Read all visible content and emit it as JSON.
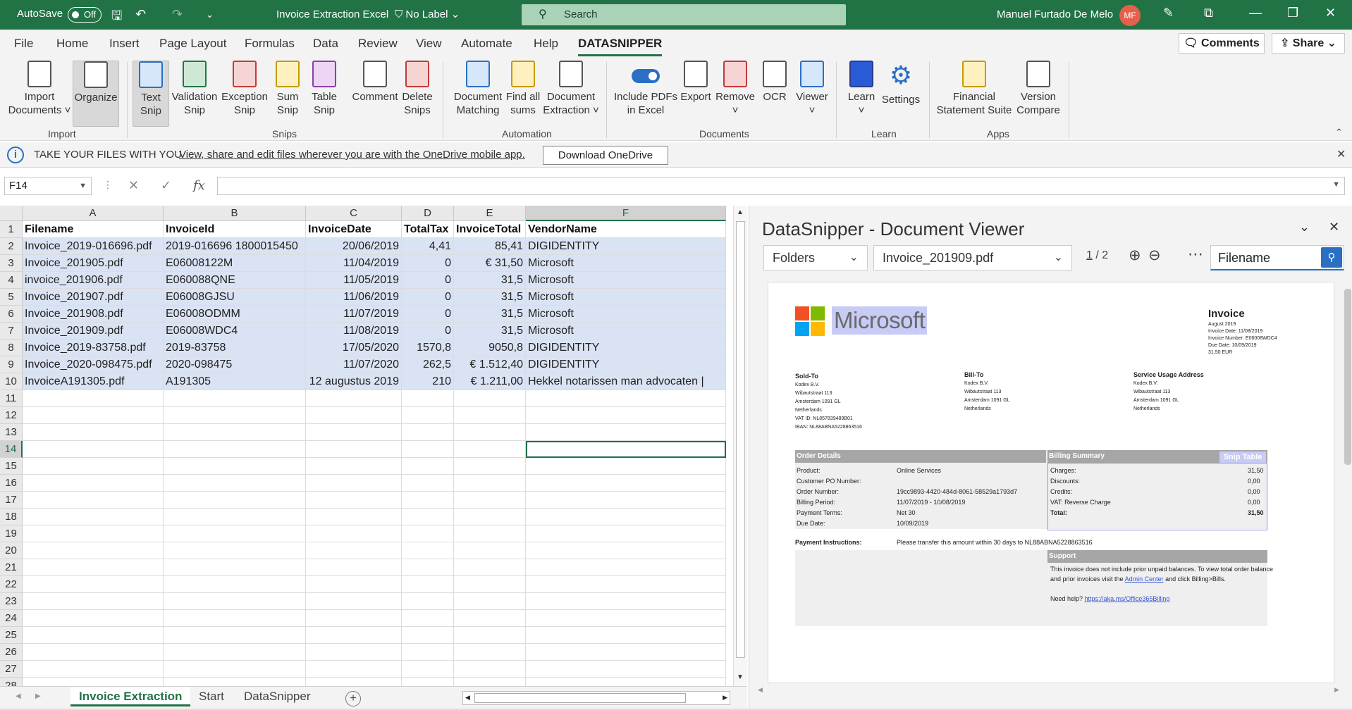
{
  "titlebar": {
    "autosave_label": "AutoSave",
    "autosave_state": "Off",
    "file_title": "Invoice Extraction Excel",
    "sensitivity": "No Label",
    "search_placeholder": "Search",
    "user_name": "Manuel Furtado De Melo",
    "user_initials": "MF"
  },
  "ribbon_tabs": [
    "File",
    "Home",
    "Insert",
    "Page Layout",
    "Formulas",
    "Data",
    "Review",
    "View",
    "Automate",
    "Help",
    "DATASNIPPER"
  ],
  "ribbon_actions": {
    "comments": "Comments",
    "share": "Share"
  },
  "ribbon": {
    "import_documents": [
      "Import",
      "Documents ˅"
    ],
    "organize": "Organize",
    "text_snip": [
      "Text",
      "Snip"
    ],
    "validation_snip": [
      "Validation",
      "Snip"
    ],
    "exception_snip": [
      "Exception",
      "Snip"
    ],
    "sum_snip": [
      "Sum",
      "Snip"
    ],
    "table_snip": [
      "Table",
      "Snip"
    ],
    "comment": "Comment",
    "delete_snips": [
      "Delete",
      "Snips"
    ],
    "document_matching": [
      "Document",
      "Matching"
    ],
    "find_all_sums": [
      "Find all",
      "sums"
    ],
    "document_extraction": [
      "Document",
      "Extraction ˅"
    ],
    "include_pdfs": [
      "Include PDFs",
      "in Excel"
    ],
    "export": "Export",
    "remove": "Remove",
    "ocr": "OCR",
    "viewer": "Viewer",
    "learn": "Learn",
    "settings": "Settings",
    "financial_statement_suite": [
      "Financial",
      "Statement Suite"
    ],
    "version_compare": [
      "Version",
      "Compare"
    ],
    "groups": [
      "Import",
      "Snips",
      "Automation",
      "Documents",
      "Learn",
      "Apps"
    ]
  },
  "message_bar": {
    "title": "TAKE YOUR FILES WITH YOU",
    "link": "View, share and edit files wherever you are with the OneDrive mobile app.",
    "button": "Download OneDrive"
  },
  "formula_bar": {
    "name_box": "F14",
    "fx": "fx",
    "value": ""
  },
  "sheet": {
    "columns": [
      "A",
      "B",
      "C",
      "D",
      "E",
      "F"
    ],
    "rows": [
      [
        "Filename",
        "InvoiceId",
        "InvoiceDate",
        "TotalTax",
        "InvoiceTotal",
        "VendorName"
      ],
      [
        "Invoice_2019-016696.pdf",
        "2019-016696 1800015450",
        "20/06/2019",
        "4,41",
        "85,41",
        "DIGIDENTITY"
      ],
      [
        "Invoice_201905.pdf",
        "E06008122M",
        "11/04/2019",
        "0",
        "€        31,50",
        " Microsoft"
      ],
      [
        "invoice_201906.pdf",
        "E060088QNE",
        "11/05/2019",
        "0",
        "31,5",
        "Microsoft"
      ],
      [
        "Invoice_201907.pdf",
        "E06008GJSU",
        "11/06/2019",
        "0",
        "31,5",
        "Microsoft"
      ],
      [
        "Invoice_201908.pdf",
        "E06008ODMM",
        "11/07/2019",
        "0",
        "31,5",
        "Microsoft"
      ],
      [
        "Invoice_201909.pdf",
        "E06008WDC4",
        "11/08/2019",
        "0",
        "31,5",
        "Microsoft"
      ],
      [
        "Invoice_2019-83758.pdf",
        "2019-83758",
        "17/05/2020",
        "1570,8",
        "9050,8",
        "DIGIDENTITY"
      ],
      [
        "Invoice_2020-098475.pdf",
        "2020-098475",
        "11/07/2020",
        "262,5",
        "€   1.512,40",
        " DIGIDENTITY"
      ],
      [
        "InvoiceA191305.pdf",
        "A191305",
        "12 augustus 2019",
        "210",
        "€   1.211,00",
        " Hekkel notarissen man advocaten |"
      ]
    ],
    "row_numbers": [
      "1",
      "2",
      "3",
      "4",
      "5",
      "6",
      "7",
      "8",
      "9",
      "10",
      "11",
      "12",
      "13",
      "14",
      "15",
      "16",
      "17",
      "18",
      "19",
      "20",
      "21",
      "22",
      "23",
      "24",
      "25",
      "26",
      "27",
      "28"
    ],
    "selected_cell": "F14"
  },
  "sheet_tabs": [
    "Invoice Extraction",
    "Start",
    "DataSnipper"
  ],
  "viewer": {
    "title": "DataSnipper - Document Viewer",
    "folders": "Folders",
    "document": "Invoice_201909.pdf",
    "page_current": "1",
    "page_total": "/ 2",
    "search_field": "Filename"
  },
  "invoice": {
    "vendor": "Microsoft",
    "heading": "Invoice",
    "meta": [
      "August 2019",
      "Invoice Date: 11/08/2019",
      "Invoice Number: E06008WDC4",
      "Due Date: 10/09/2019",
      "31,50 EUR"
    ],
    "sold_to": {
      "label": "Sold-To",
      "lines": [
        "Kodex B.V.",
        "Wibautstraat 113",
        "Amsterdam 1091 GL",
        "Netherlands",
        "VAT ID: NL857839489B01",
        "IBAN: NL88ABNA5228863516"
      ]
    },
    "bill_to": {
      "label": "Bill-To",
      "lines": [
        "Kodex B.V.",
        "Wibautstraat 113",
        "Amsterdam 1091 GL",
        "Netherlands"
      ]
    },
    "service_address": {
      "label": "Service Usage Address",
      "lines": [
        "Kodex B.V.",
        "Wibautstraat 113",
        "Amsterdam 1091 GL",
        "Netherlands"
      ]
    },
    "order_details_title": "Order Details",
    "billing_summary_title": "Billing Summary",
    "snip_label": "Snip Table",
    "order_details": [
      [
        "Product:",
        "Online Services"
      ],
      [
        "Customer PO Number:",
        ""
      ],
      [
        "Order Number:",
        "19cc9893-4420-484d-8061-58529a1793d7"
      ],
      [
        "Billing Period:",
        "11/07/2019 - 10/08/2019"
      ],
      [
        "Payment Terms:",
        "Net 30"
      ],
      [
        "Due Date:",
        "10/09/2019"
      ]
    ],
    "billing_summary": [
      [
        "Charges:",
        "31,50"
      ],
      [
        "Discounts:",
        "0,00"
      ],
      [
        "Credits:",
        "0,00"
      ],
      [
        "VAT: Reverse Charge",
        "0,00"
      ],
      [
        "Total:",
        "31,50"
      ]
    ],
    "payment_label": "Payment Instructions:",
    "payment_text": "Please transfer this amount within 30 days to NL88ABNA5228863516",
    "support_title": "Support",
    "support_line1": "This invoice does not include prior unpaid balances. To view total order balance",
    "support_line2_a": "and prior invoices visit the ",
    "support_link": "Admin Center",
    "support_line2_b": " and click Billing>Bills.",
    "help_label": "Need help? ",
    "help_link": "https://aka.ms/Office365Billing"
  },
  "colors": {
    "excel_green": "#217346",
    "snip_fill": "#dae3f3",
    "ds_blue": "#2a6fc4"
  }
}
